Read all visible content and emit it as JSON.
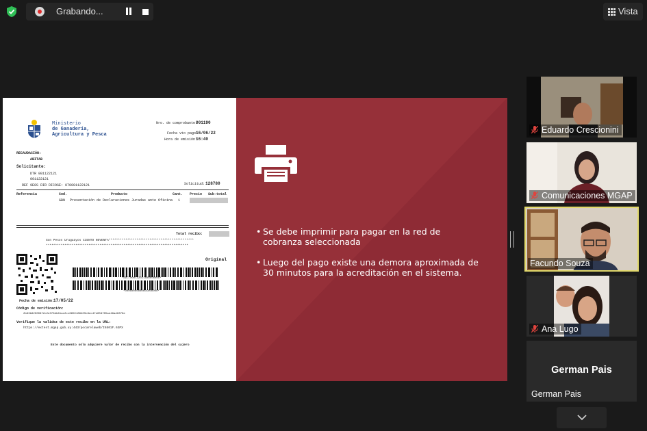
{
  "recording": {
    "label": "Grabando..."
  },
  "view_button": {
    "label": "Vista"
  },
  "slide": {
    "bullets": [
      "Se debe imprimir para pagar en la red de cobranza seleccionada",
      "Luego del pago existe una demora aproximada de 30 minutos para la acreditación en el sistema."
    ],
    "accent_color": "#963039"
  },
  "receipt": {
    "ministry_lines": [
      "Ministerio",
      "de Ganadería,",
      "Agricultura y Pesca"
    ],
    "comprobante_label": "Nro. de comprobante:",
    "comprobante_value": "001190",
    "fecha_vto_label": "Fecha vto pago:",
    "fecha_vto_value": "16/06/22",
    "hora_label": "Hora de emisión:",
    "hora_value": "16:40",
    "recaudacion_label": "RECAUDACIÓN:",
    "recaudacion_value": "ABITAB",
    "solicitante_label": "Solicitante:",
    "sol_line1": "DTR 001122121",
    "sol_line2": "001122121",
    "ref_line": "REF 9E0S DIR DICOSE: 070001122121",
    "solicitud_label": "Solicitud:",
    "solicitud_value": "128780",
    "headers": [
      "Referencia",
      "Cod.",
      "Producto",
      "Cant.",
      "Precio",
      "Sub-total"
    ],
    "row": {
      "cod": "GBN",
      "producto": "Presentación de Declaraciones Juradas ante Oficina",
      "cant": "1"
    },
    "total_label": "Total recibo:",
    "son_pesos": "Son Pesos Uruguayos CIENTO NOVENTA**********************************************",
    "stars_line": "*****************************************************************************",
    "original": "Original",
    "barcode_text1": "*BDCT000142021000000000*",
    "barcode_text2": "*00000000000001000000*",
    "fecha_emision_label": "Fecha de emisión:",
    "fecha_emision_value": "17/05/22",
    "codigo_label": "Código de verificación:",
    "codigo_value": "2b63b620006f2c2e376db61ac2cc695018840Sc9ec4fe659f05ae46ad9378e",
    "verifique_label": "Verifique la validez de este recibo en la URL:",
    "url": "https://extest.mgap.gub.uy:443/pocarelaweb/I6501F.6GPX",
    "footer": "Este documento sólo adquiere valor de recibo con la intervención del cajero"
  },
  "participants": [
    {
      "name": "Eduardo Crescionini",
      "muted": true
    },
    {
      "name": "Comunicaciones MGAP",
      "muted": true
    },
    {
      "name": "Facundo Souza",
      "muted": false,
      "active": true
    },
    {
      "name": "Ana Lugo",
      "muted": true
    },
    {
      "name": "German Pais",
      "muted": false,
      "video": false
    }
  ],
  "colors": {
    "active_speaker": "#e2d96b",
    "muted": "#e0443e",
    "shield": "#2fbf56"
  }
}
